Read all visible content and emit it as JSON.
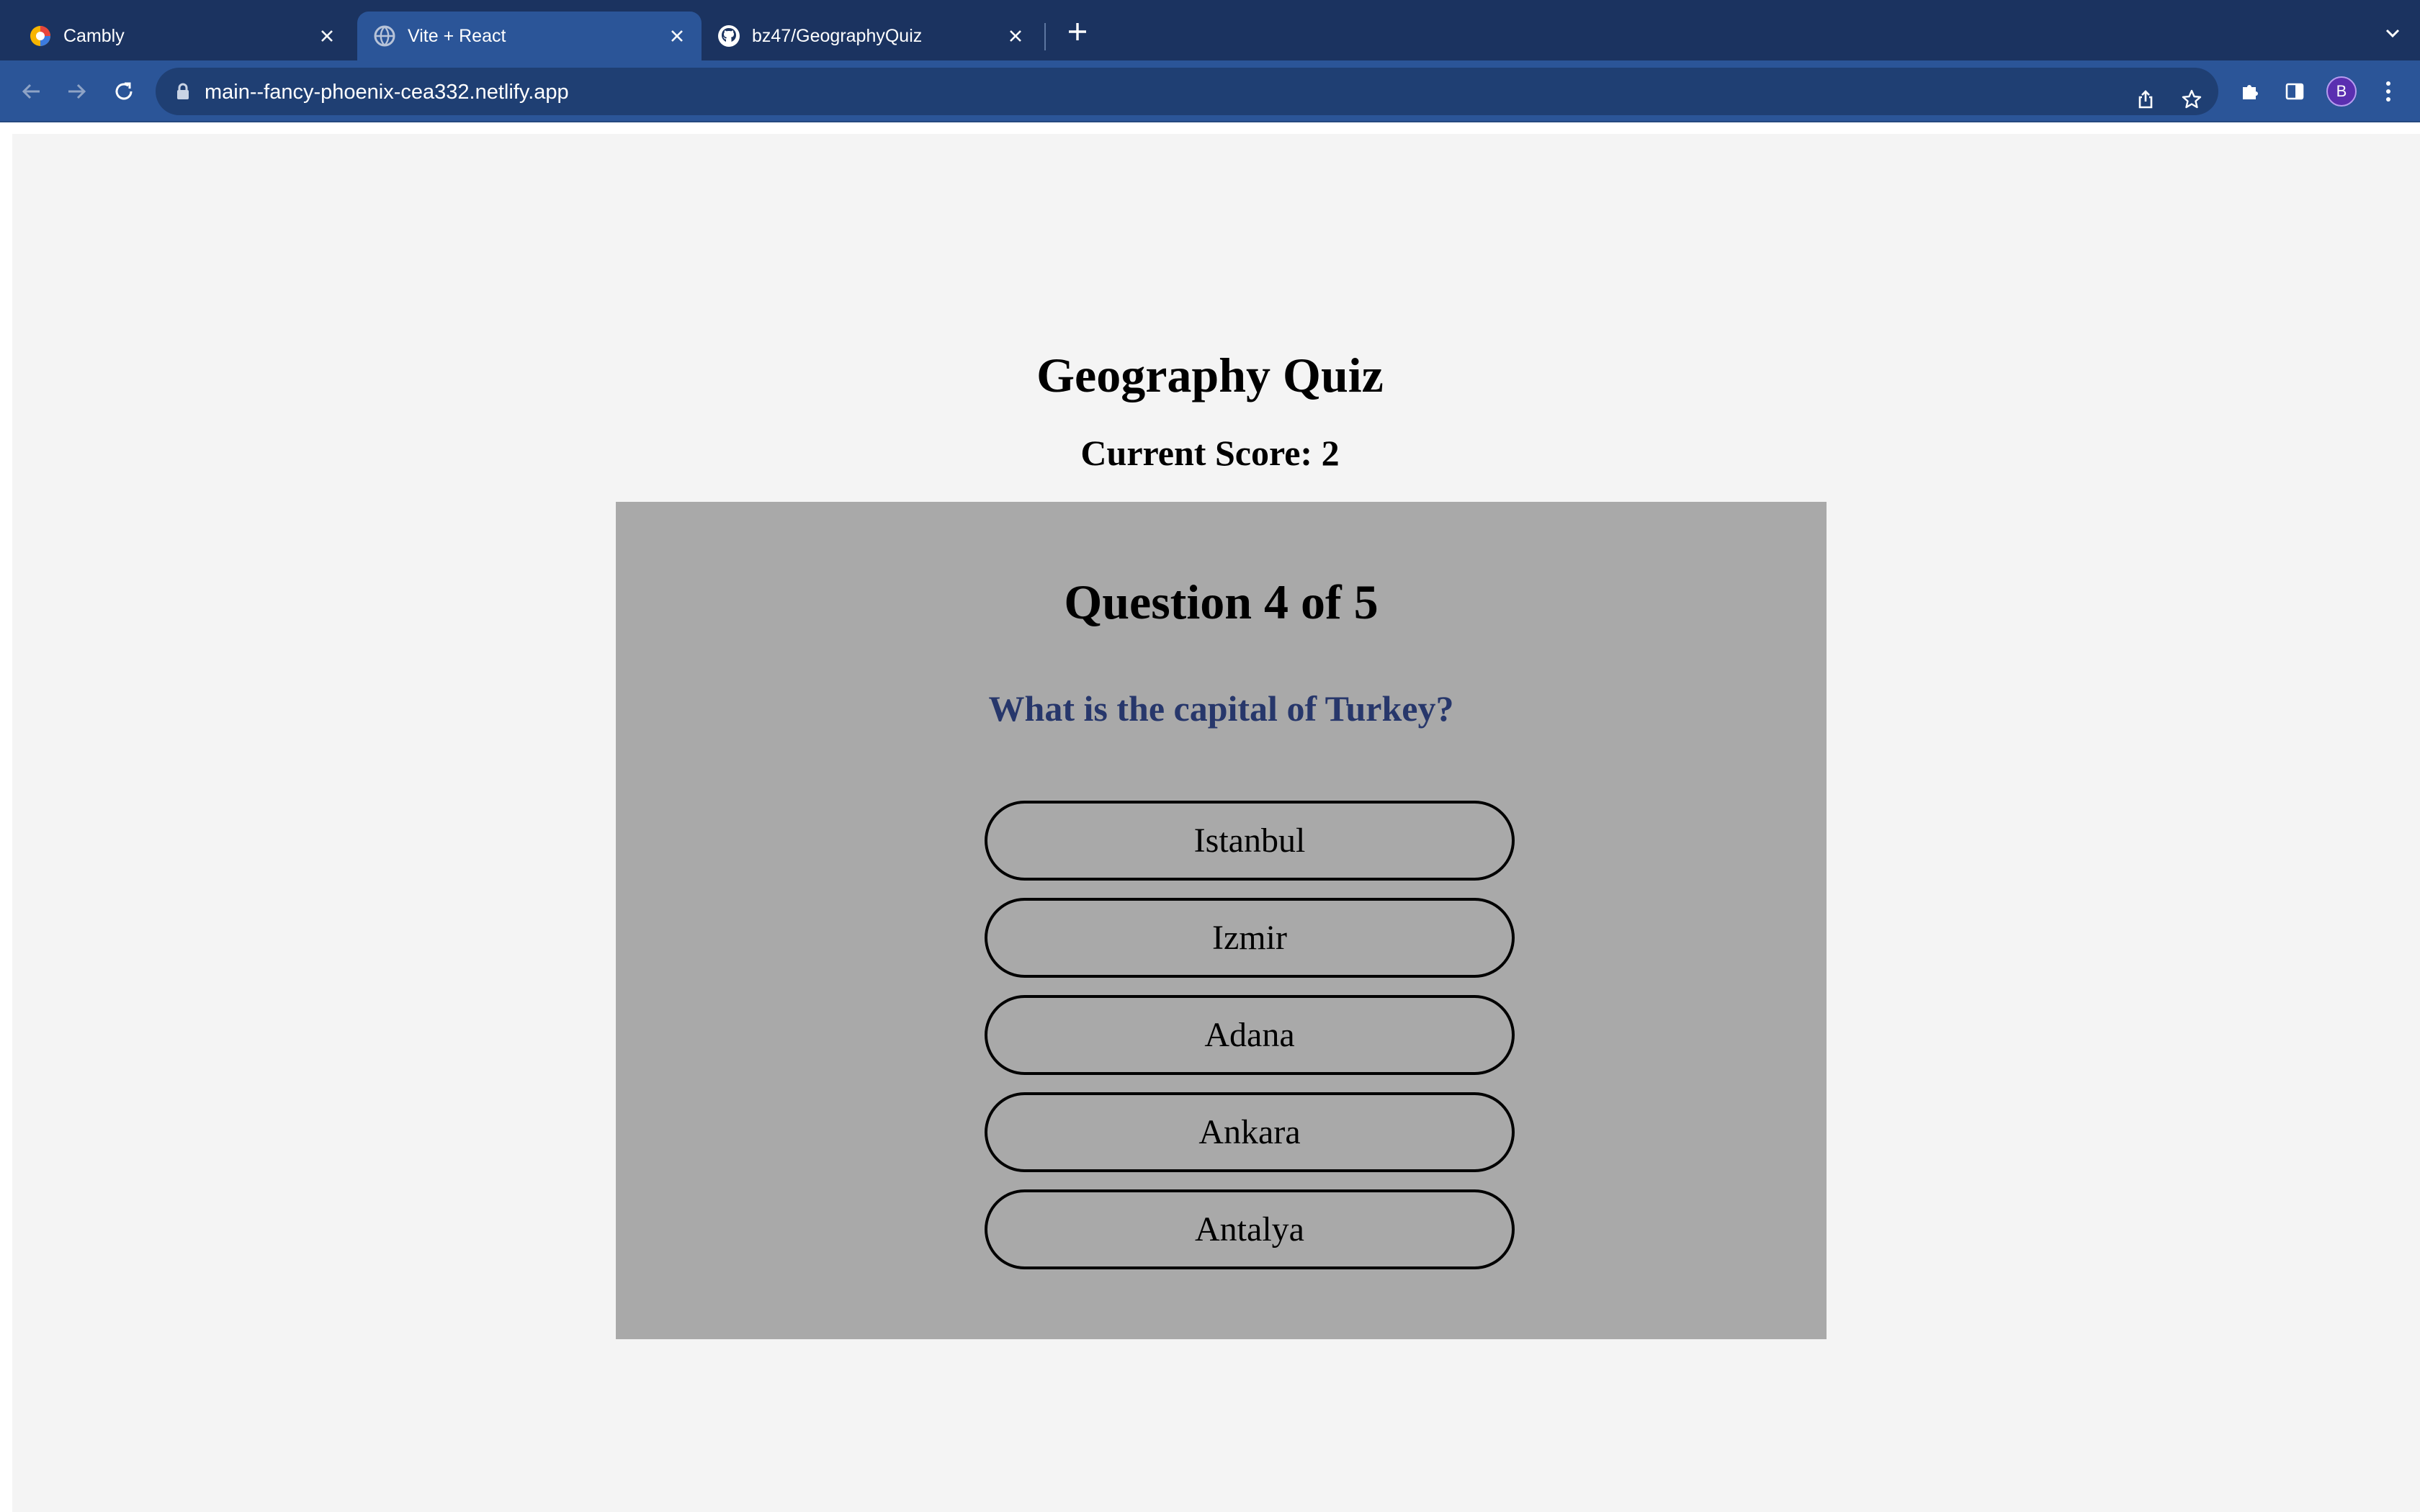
{
  "browser": {
    "tabs": [
      {
        "title": "Cambly",
        "icon": "cambly-favicon",
        "active": false
      },
      {
        "title": "Vite + React",
        "icon": "globe-favicon",
        "active": true
      },
      {
        "title": "bz47/GeographyQuiz",
        "icon": "github-favicon",
        "active": false
      }
    ],
    "url": "main--fancy-phoenix-cea332.netlify.app",
    "profile_initial": "B",
    "colors": {
      "frame": "#1b3360",
      "toolbar": "#2b5598",
      "omnibox": "#1f3f73"
    }
  },
  "app": {
    "title": "Geography Quiz",
    "score_text": "Current Score: 2",
    "question_count": "Question 4 of 5",
    "question": "What is the capital of Turkey?",
    "answers": [
      "Istanbul",
      "Izmir",
      "Adana",
      "Ankara",
      "Antalya"
    ],
    "colors": {
      "card": "#a9a9a9",
      "question": "#27376b",
      "page": "#f4f4f4"
    }
  }
}
